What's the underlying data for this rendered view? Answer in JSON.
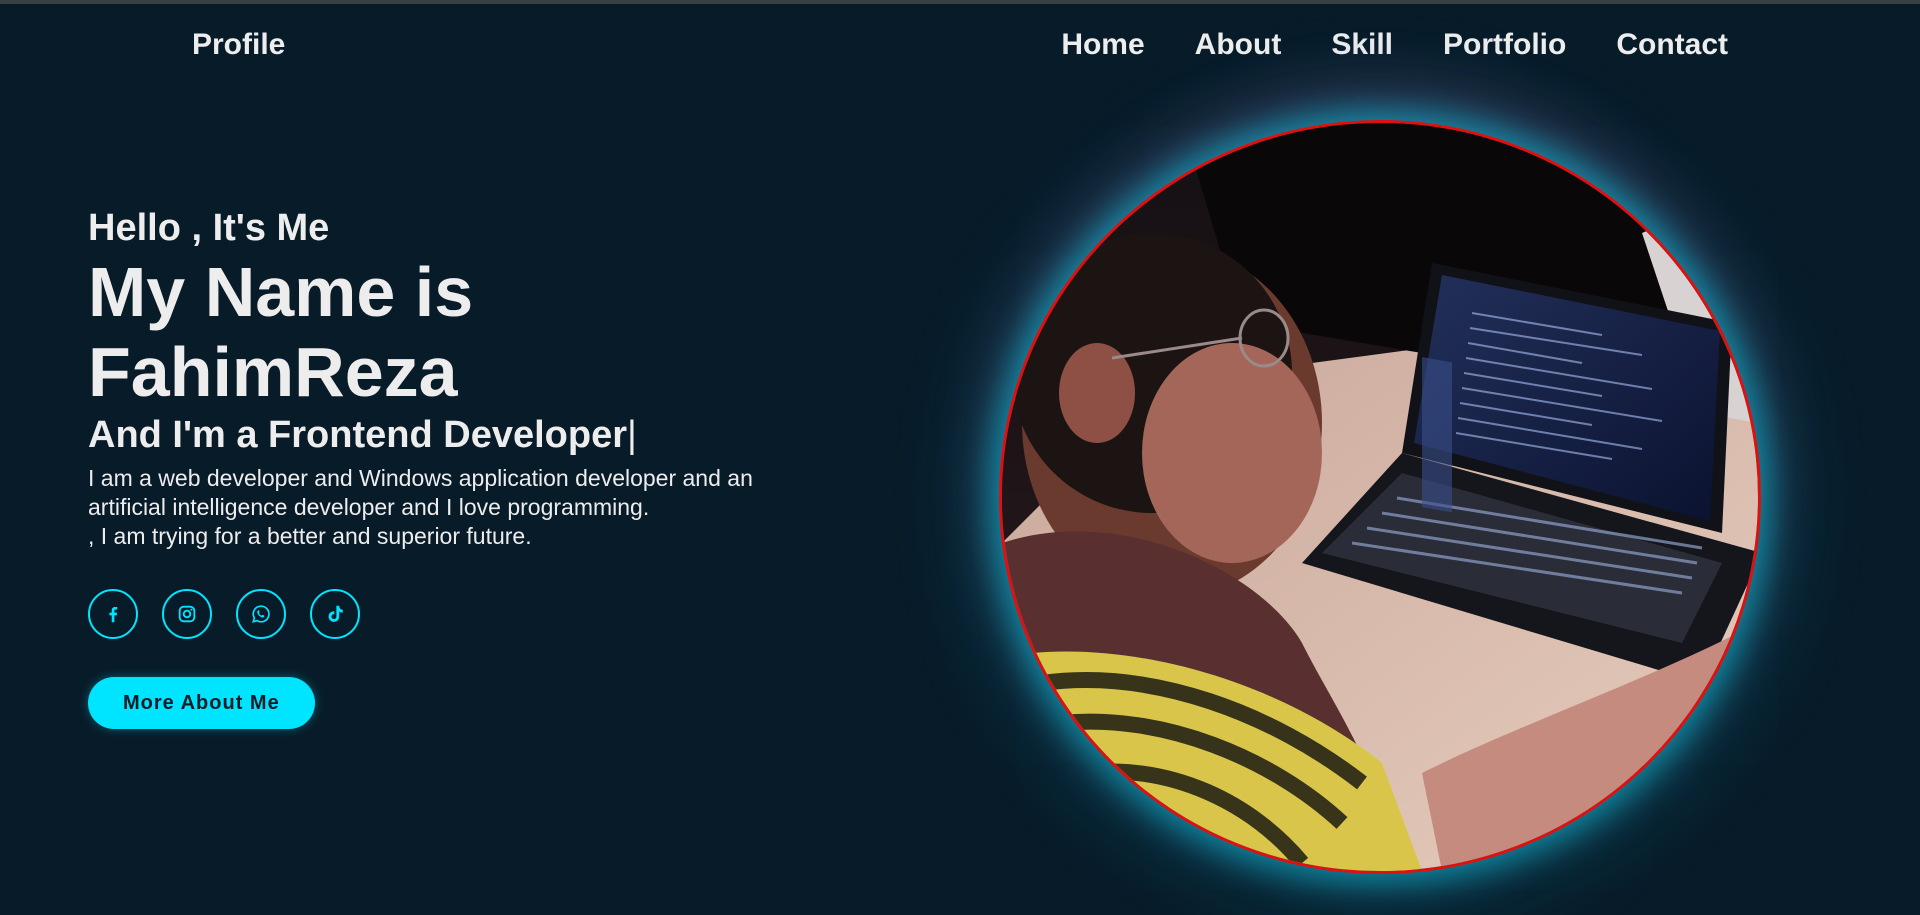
{
  "header": {
    "logo": "Profile",
    "nav": [
      "Home",
      "About",
      "Skill",
      "Portfolio",
      "Contact"
    ]
  },
  "hero": {
    "greeting": "Hello , It's Me",
    "name_line1": "My Name is",
    "name_line2": "FahimReza",
    "role": "And I'm a Frontend Developer",
    "cursor": "|",
    "description_line1": "I am a web developer and Windows application developer and an",
    "description_line2": "artificial intelligence developer and I love programming.",
    "description_line3": ", I am trying for a better and superior future.",
    "socials": [
      "facebook-icon",
      "instagram-icon",
      "whatsapp-icon",
      "tiktok-icon"
    ],
    "button_label": "More About Me"
  },
  "colors": {
    "background": "#081b29",
    "accent": "#00e5ff",
    "text": "#ededed",
    "photo_border": "#e01010"
  }
}
